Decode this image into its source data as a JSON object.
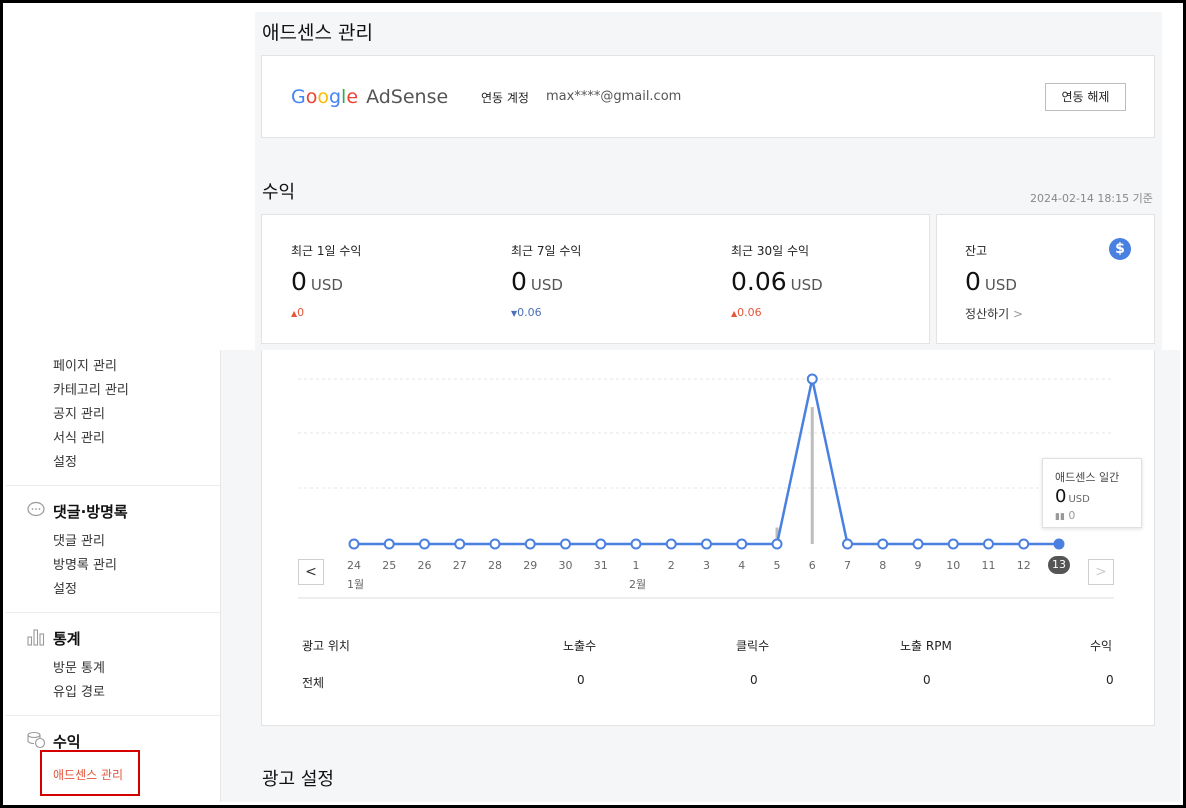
{
  "page": {
    "title": "애드센스 관리"
  },
  "adsense": {
    "logo_google": "Google",
    "logo_product": "AdSense",
    "account_label": "연동 계정",
    "account_email": "max****@gmail.com",
    "unlink_button": "연동 해제"
  },
  "revenue": {
    "section_title": "수익",
    "updated_at": "2024-02-14 18:15 기준",
    "stats": [
      {
        "label": "최근 1일 수익",
        "value": "0",
        "unit": "USD",
        "delta": "0",
        "direction": "up"
      },
      {
        "label": "최근 7일 수익",
        "value": "0",
        "unit": "USD",
        "delta": "0.06",
        "direction": "down"
      },
      {
        "label": "최근 30일 수익",
        "value": "0.06",
        "unit": "USD",
        "delta": "0.06",
        "direction": "up"
      }
    ],
    "balance": {
      "label": "잔고",
      "value": "0",
      "unit": "USD",
      "settle_link": "정산하기",
      "icon": "dollar-icon"
    }
  },
  "chart_data": {
    "type": "line",
    "x": [
      "24",
      "25",
      "26",
      "27",
      "28",
      "29",
      "30",
      "31",
      "1",
      "2",
      "3",
      "4",
      "5",
      "6",
      "7",
      "8",
      "9",
      "10",
      "11",
      "12",
      "13"
    ],
    "month_labels": [
      {
        "index": 0,
        "label": "1월"
      },
      {
        "index": 8,
        "label": "2월"
      }
    ],
    "series": [
      {
        "values": [
          0,
          0,
          0,
          0,
          0,
          0,
          0,
          0,
          0,
          0,
          0,
          0,
          0,
          0.06,
          0,
          0,
          0,
          0,
          0,
          0,
          0
        ]
      }
    ],
    "bars": [
      0,
      0,
      0,
      0,
      0,
      0,
      0,
      0,
      0,
      0,
      0,
      0,
      0.1,
      0.83,
      0,
      0,
      0,
      0,
      0,
      0,
      0
    ],
    "selected_index": 20,
    "tooltip": {
      "title": "애드센스 일간",
      "value": "0",
      "unit": "USD",
      "sub_value": "0"
    },
    "colors": {
      "line": "#4a80e0",
      "bar": "#bdbdbd",
      "selected_badge": "#555555"
    }
  },
  "table": {
    "headers": [
      "광고 위치",
      "노출수",
      "클릭수",
      "노출 RPM",
      "수익"
    ],
    "rows": [
      [
        "전체",
        "0",
        "0",
        "0",
        "0"
      ]
    ]
  },
  "ad_settings": {
    "title": "광고 설정"
  },
  "sidebar": {
    "items_top": [
      "페이지 관리",
      "카테고리 관리",
      "공지 관리",
      "서식 관리",
      "설정"
    ],
    "sections": [
      {
        "title": "댓글·방명록",
        "icon": "chat-bubble-icon",
        "items": [
          "댓글 관리",
          "방명록 관리",
          "설정"
        ]
      },
      {
        "title": "통계",
        "icon": "bar-chart-icon",
        "items": [
          "방문 통계",
          "유입 경로"
        ]
      },
      {
        "title": "수익",
        "icon": "coins-icon",
        "items": [
          "애드센스 관리"
        ]
      }
    ]
  }
}
